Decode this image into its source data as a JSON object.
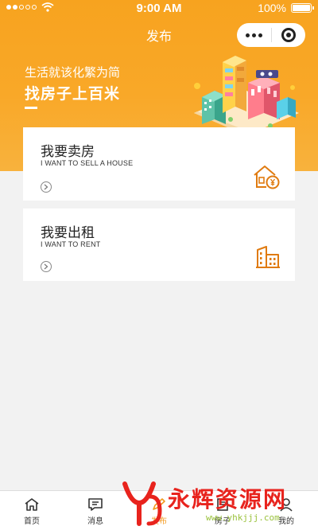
{
  "status_bar": {
    "time": "9:00 AM",
    "battery": "100%",
    "signal_icon": "signal-dots-icon",
    "wifi_icon": "wifi-icon",
    "battery_icon": "battery-icon"
  },
  "nav": {
    "title": "发布",
    "more_icon": "more-dots-icon",
    "close_icon": "target-close-icon"
  },
  "banner": {
    "subtitle": "生活就该化繁为简",
    "title": "找房子上百米",
    "illustration": "city-buildings-illustration"
  },
  "cards": [
    {
      "title": "我要卖房",
      "subtitle": "I WANT TO SELL A HOUSE",
      "icon": "house-yuan-icon",
      "arrow_icon": "arrow-right-circle-icon"
    },
    {
      "title": "我要出租",
      "subtitle": "I WANT TO RENT",
      "icon": "building-icon",
      "arrow_icon": "arrow-right-circle-icon"
    }
  ],
  "tabbar": {
    "items": [
      {
        "label": "首页",
        "icon": "home-icon"
      },
      {
        "label": "消息",
        "icon": "message-icon"
      },
      {
        "label": "发布",
        "icon": "publish-icon",
        "active": true
      },
      {
        "label": "房子",
        "icon": "house-list-icon"
      },
      {
        "label": "我的",
        "icon": "user-icon"
      }
    ]
  },
  "watermark": {
    "text": "永辉资源网",
    "url": "www.yhkjjj.com"
  },
  "colors": {
    "accent": "#f7a31f",
    "icon_orange": "#e07b10",
    "watermark_red": "#e8231d",
    "page_bg": "#f2f2f2"
  }
}
